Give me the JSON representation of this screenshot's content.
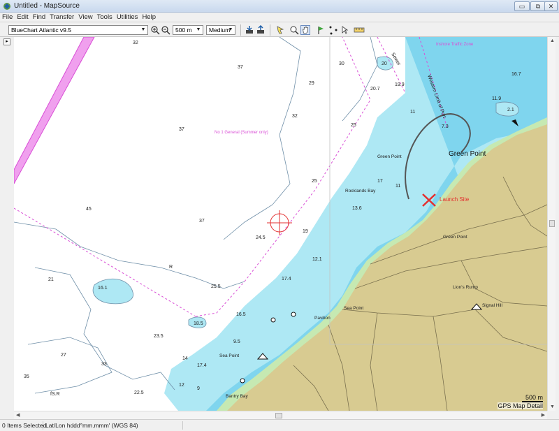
{
  "window": {
    "title": "Untitled - MapSource",
    "buttons": [
      "▭",
      "⧉",
      "✕"
    ]
  },
  "menu": [
    "File",
    "Edit",
    "Find",
    "Transfer",
    "View",
    "Tools",
    "Utilities",
    "Help"
  ],
  "toolbar": {
    "product": "BlueChart Atlantic v9.5",
    "zoom": "500 m",
    "detail": "Medium"
  },
  "map": {
    "soundings": [
      {
        "label": "32"
      },
      {
        "label": "37"
      },
      {
        "label": "29"
      },
      {
        "label": "30"
      },
      {
        "label": "20"
      },
      {
        "label": "19.9"
      },
      {
        "label": "20.7"
      },
      {
        "label": "16.7"
      },
      {
        "label": "11.9"
      },
      {
        "label": "2.1"
      },
      {
        "label": "37"
      },
      {
        "label": "32"
      },
      {
        "label": "25"
      },
      {
        "label": "11"
      },
      {
        "label": "7.3"
      },
      {
        "label": "45"
      },
      {
        "label": "25"
      },
      {
        "label": "17"
      },
      {
        "label": "11"
      },
      {
        "label": "13.6"
      },
      {
        "label": "37"
      },
      {
        "label": "24.5"
      },
      {
        "label": "19"
      },
      {
        "label": "12.1"
      },
      {
        "label": "21"
      },
      {
        "label": "16.1"
      },
      {
        "label": "25.5"
      },
      {
        "label": "17.4"
      },
      {
        "label": "16.5"
      },
      {
        "label": "18.5"
      },
      {
        "label": "23.5"
      },
      {
        "label": "9.5"
      },
      {
        "label": "27"
      },
      {
        "label": "33"
      },
      {
        "label": "14"
      },
      {
        "label": "17.4"
      },
      {
        "label": "35"
      },
      {
        "label": "12"
      },
      {
        "label": "9"
      },
      {
        "label": "22.5"
      }
    ],
    "place_labels": [
      {
        "label": "Green Point"
      },
      {
        "label": "Rocklands Bay"
      },
      {
        "label": "Green Point"
      },
      {
        "label": "Lion's Rump"
      },
      {
        "label": "Signal Hill"
      },
      {
        "label": "Sea Point"
      },
      {
        "label": "Pavilion"
      },
      {
        "label": "Sea Point"
      },
      {
        "label": "Bantry Bay"
      }
    ],
    "seabed_labels": [
      {
        "label": "R"
      },
      {
        "label": "fS.R"
      }
    ],
    "magenta_labels": [
      {
        "label": "Inshore Traffic Zone"
      },
      {
        "label": "No 1 General (Summer only)"
      }
    ],
    "rotated_labels": [
      {
        "label": "Sewer"
      },
      {
        "label": "Western Limit of Port"
      }
    ],
    "big_label": "Green Point",
    "launch_label": "Launch Site",
    "scale": {
      "value": "500 m",
      "detail": "GPS Map Detail"
    },
    "colors": {
      "deep": "#ffffff",
      "water_mid": "#aee8f4",
      "water_shallow": "#7fd5ee",
      "land": "#d8cb91",
      "intertidal": "#c6e9b2",
      "magenta": "#d94fd6",
      "launch_red": "#e33030"
    }
  },
  "status": {
    "items_selected": "0 Items Selected",
    "coord_format": "Lat/Lon hddd°mm.mmm' (WGS 84)"
  }
}
